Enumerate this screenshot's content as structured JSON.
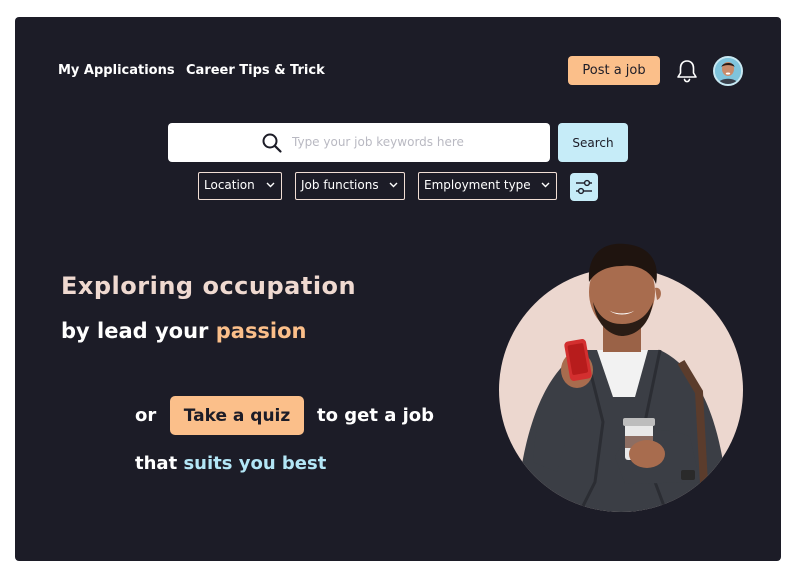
{
  "nav": {
    "links": [
      "My Applications",
      "Career Tips & Trick"
    ],
    "post_job_label": "Post a job",
    "bell_icon": "bell-icon",
    "avatar_icon": "user-avatar"
  },
  "search": {
    "placeholder": "Type your job keywords here",
    "value": "",
    "button_label": "Search",
    "icon": "search-icon"
  },
  "filters": {
    "location": "Location",
    "job_functions": "Job functions",
    "employment_type": "Employment type",
    "filter_icon": "sliders-icon"
  },
  "hero": {
    "line1": "Exploring occupation",
    "line2_prefix": "by lead your ",
    "line2_highlight": "passion",
    "or_text": "or",
    "quiz_button": "Take a quiz",
    "line3_suffix": "to get a job",
    "line4_prefix": "that ",
    "line4_highlight": "suits you best"
  },
  "colors": {
    "background": "#1c1c27",
    "accent_orange": "#fbbf8a",
    "accent_blue": "#c6ecf8",
    "heading_pink": "#efd9d0",
    "circle_pink": "#ecd7cf"
  }
}
